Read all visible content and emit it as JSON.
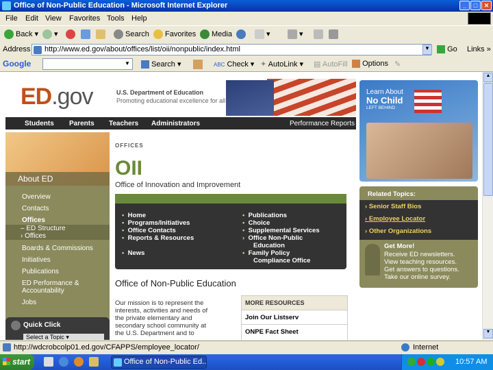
{
  "window": {
    "title": "Office of Non-Public Education - Microsoft Internet Explorer"
  },
  "menu": [
    "File",
    "Edit",
    "View",
    "Favorites",
    "Tools",
    "Help"
  ],
  "toolbar": {
    "back": "Back",
    "search": "Search",
    "favorites": "Favorites",
    "media": "Media"
  },
  "address": {
    "label": "Address",
    "url": "http://www.ed.gov/about/offices/list/oii/nonpublic/index.html",
    "go": "Go",
    "links": "Links"
  },
  "google": {
    "logo": "Google",
    "search": "Search",
    "check": "Check",
    "autolink": "AutoLink",
    "autofill": "AutoFill",
    "options": "Options"
  },
  "site": {
    "logo_ed": "ED",
    "logo_gov": ".gov",
    "dept": "U.S. Department of Education",
    "tagline": "Promoting educational excellence for all Americans.",
    "nav": [
      "Students",
      "Parents",
      "Teachers",
      "Administrators"
    ],
    "perf": "Performance Reports",
    "about": "About ED",
    "left_nav": [
      "Overview",
      "Contacts",
      "Offices",
      "Boards & Commissions",
      "Initiatives",
      "Publications",
      "ED Performance &",
      "Accountability",
      "Jobs"
    ],
    "sub_nav": [
      "ED Structure",
      "Offices"
    ],
    "quick_click": "Quick Click",
    "select_topic": "Select a Topic",
    "offices_label": "OFFICES",
    "oii": "OII",
    "oii_full": "Office of Innovation and Improvement",
    "menu_left": [
      "Home",
      "Programs/Initiatives",
      "Office Contacts",
      "Reports & Resources",
      "News"
    ],
    "menu_right": [
      "Publications",
      "Choice",
      "Supplemental Services",
      "Office Non-Public",
      "Education",
      "Family Policy",
      "Compliance Office"
    ],
    "page_heading": "Office of Non-Public Education",
    "mission": [
      "Our mission is to represent the",
      "interests, activities and needs of",
      "the private elementary and",
      "secondary school community at",
      "the U.S. Department and to"
    ],
    "more_resources": "MORE RESOURCES",
    "resources": [
      "Join Our Listserv",
      "ONPE Fact Sheet"
    ],
    "nclb": {
      "learn": "Learn About",
      "no_child": "No Child",
      "left_behind": "LEFT BEHIND"
    },
    "related_title": "Related Topics:",
    "related": [
      "Senior Staff Bios",
      "Employee Locator",
      "Other Organizations"
    ],
    "getmore_title": "Get More!",
    "getmore": [
      "Receive ED newsletters.",
      "View teaching resources.",
      "Get answers to questions.",
      "Take our online survey."
    ]
  },
  "status": {
    "url": "http://wdcrobcolp01.ed.gov/CFAPPS/employee_locator/",
    "zone": "Internet"
  },
  "taskbar": {
    "start": "start",
    "item": "Office of Non-Public Ed...",
    "clock": "10:57 AM"
  },
  "colors": {
    "olive": "#8a8a5c",
    "dark": "#2b2b2b",
    "green": "#6a8a3a",
    "ed_orange": "#c0501a"
  }
}
